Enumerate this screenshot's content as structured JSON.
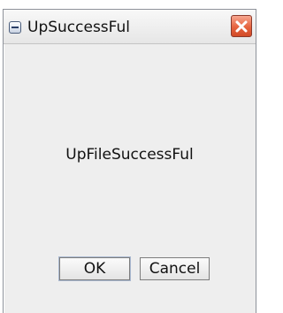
{
  "window": {
    "title": "UpSuccessFul",
    "menu_icon": "window-menu-icon",
    "close_icon": "close-icon"
  },
  "dialog": {
    "message": "UpFileSuccessFul",
    "ok_label": "OK",
    "cancel_label": "Cancel"
  },
  "colors": {
    "close_button": "#e6633e",
    "background": "#eeeeee"
  }
}
